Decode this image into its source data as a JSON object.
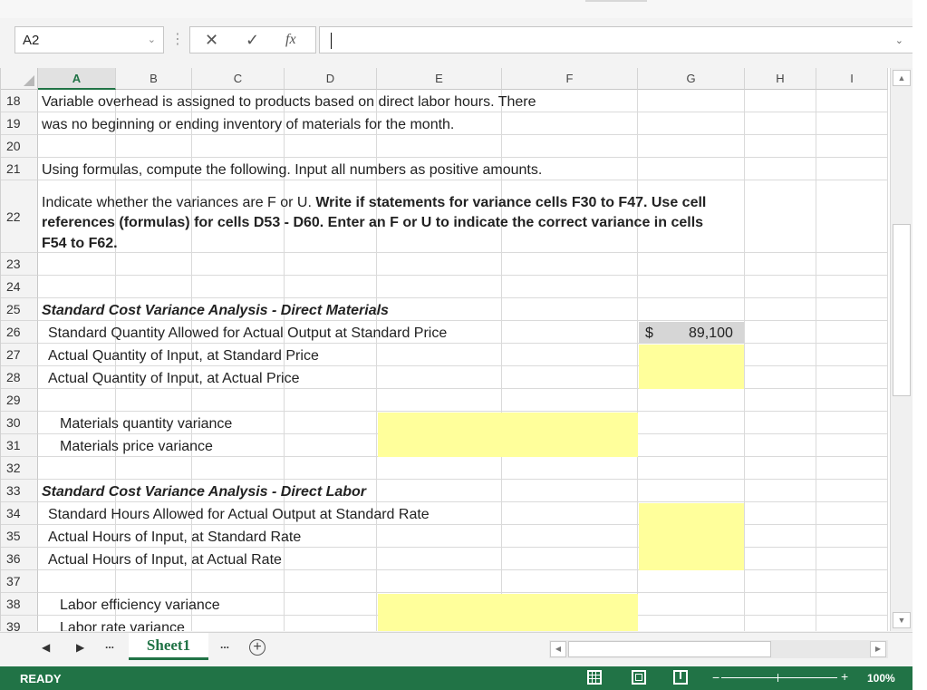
{
  "formula_bar": {
    "name_box": "A2",
    "divider": "⋮",
    "cancel_icon": "✕",
    "enter_icon": "✓",
    "function_icon": "fx",
    "formula_value": ""
  },
  "columns": [
    "A",
    "B",
    "C",
    "D",
    "E",
    "F",
    "G",
    "H",
    "I"
  ],
  "selected_column": "A",
  "rows": {
    "r18": {
      "num": "18",
      "a": "Variable overhead is assigned to products based on direct labor hours. There"
    },
    "r19": {
      "num": "19",
      "a": "was no beginning or ending inventory of materials for the month."
    },
    "r20": {
      "num": "20"
    },
    "r21": {
      "num": "21",
      "a": "Using formulas, compute the following.  Input all numbers as positive amounts."
    },
    "r22": {
      "num": "22",
      "line1_normal": "Indicate whether the variances are F or U.",
      "line1_bold": " Write if statements for variance cells F30 to F47. Use cell",
      "line2": "references (formulas) for cells D53 - D60. Enter an  F or U to indicate the correct variance in cells",
      "line3": "F54 to F62."
    },
    "r23": {
      "num": "23"
    },
    "r24": {
      "num": "24"
    },
    "r25": {
      "num": "25",
      "a": "Standard Cost Variance Analysis - Direct Materials"
    },
    "r26": {
      "num": "26",
      "a": "Standard Quantity Allowed for Actual Output at Standard Price",
      "g_currency": "$",
      "g_value": "89,100"
    },
    "r27": {
      "num": "27",
      "a": "Actual Quantity of Input, at Standard Price"
    },
    "r28": {
      "num": "28",
      "a": "Actual Quantity of Input, at Actual Price"
    },
    "r29": {
      "num": "29"
    },
    "r30": {
      "num": "30",
      "a": "Materials quantity variance"
    },
    "r31": {
      "num": "31",
      "a": "Materials price variance"
    },
    "r32": {
      "num": "32"
    },
    "r33": {
      "num": "33",
      "a": "Standard Cost Variance Analysis - Direct Labor"
    },
    "r34": {
      "num": "34",
      "a": "Standard Hours Allowed for Actual Output at Standard Rate"
    },
    "r35": {
      "num": "35",
      "a": "Actual Hours of Input, at Standard Rate"
    },
    "r36": {
      "num": "36",
      "a": "Actual Hours of Input, at Actual Rate"
    },
    "r37": {
      "num": "37"
    },
    "r38": {
      "num": "38",
      "a": "Labor efficiency variance"
    },
    "r39": {
      "num": "39",
      "a": "Labor rate variance"
    }
  },
  "sheet_tabs": {
    "prev": "◀",
    "next": "▶",
    "more_left": "...",
    "active": "Sheet1",
    "more_right": "...",
    "add": "+"
  },
  "status": {
    "mode": "READY",
    "zoom": "100%",
    "zoom_minus": "−",
    "zoom_plus": "+"
  },
  "colors": {
    "accent": "#217346",
    "input_highlight": "#ffff9b",
    "prefilled": "#d6d6d6"
  }
}
